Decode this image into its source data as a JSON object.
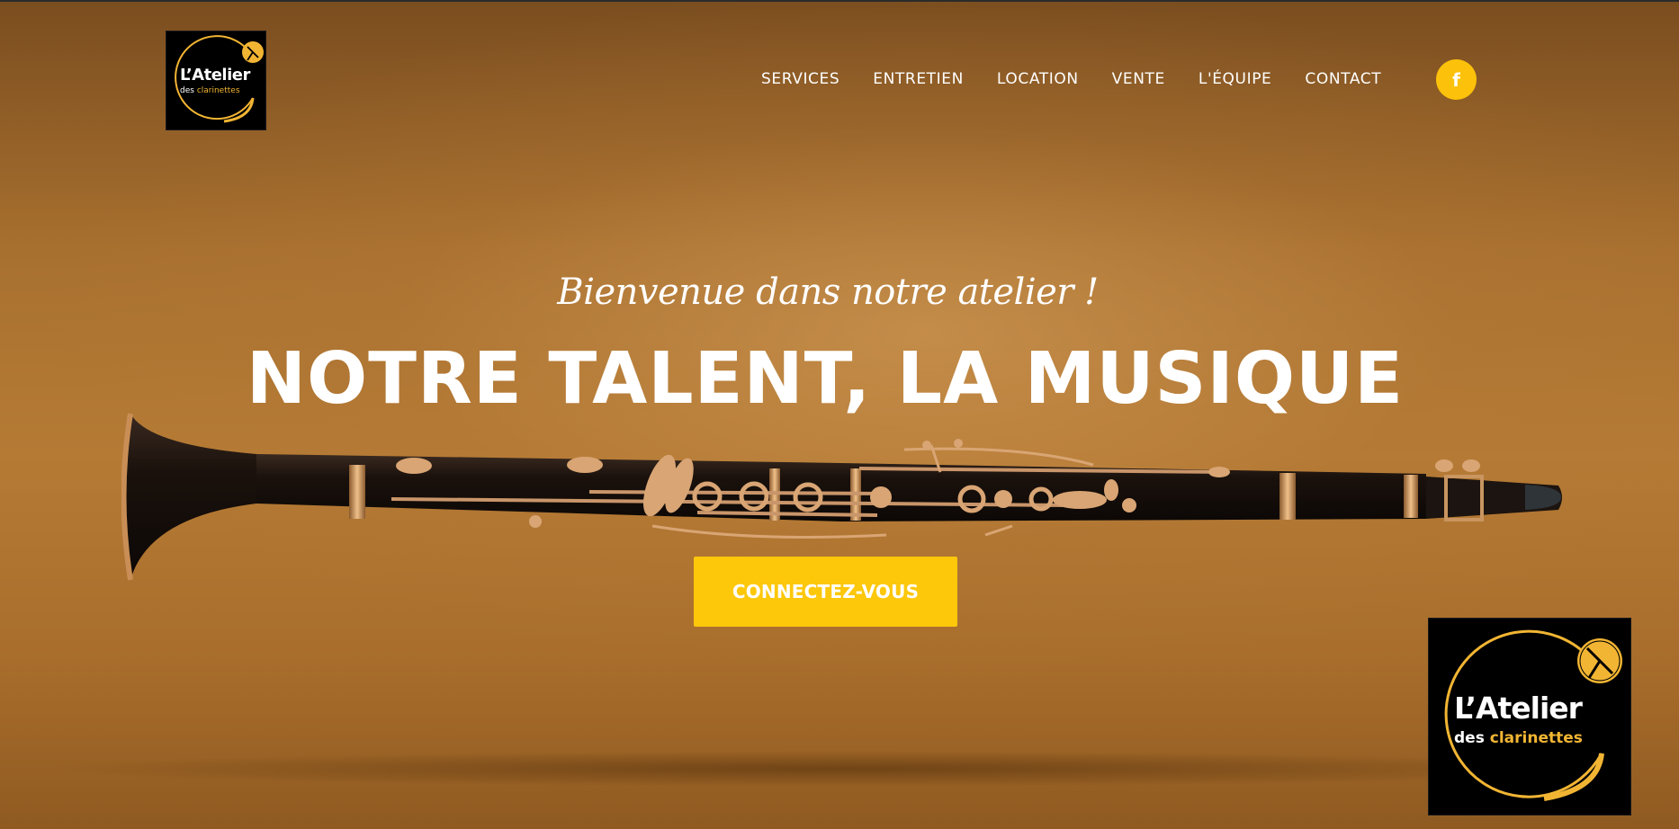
{
  "brand": {
    "name_part1": "L’",
    "name_part2": "Atelier",
    "subtitle_part1": "des ",
    "subtitle_part2": "clarinettes",
    "accent_color": "#f2b533"
  },
  "nav": {
    "items": [
      "SERVICES",
      "ENTRETIEN",
      "LOCATION",
      "VENTE",
      "L'ÉQUIPE",
      "CONTACT"
    ],
    "facebook_glyph": "f",
    "facebook_color": "#fcc10a"
  },
  "hero": {
    "tagline": "Bienvenue dans notre atelier !",
    "headline": "NOTRE TALENT, LA MUSIQUE",
    "cta_label": "CONNECTEZ-VOUS",
    "cta_color": "#fdc70a",
    "image": "clarinet"
  }
}
